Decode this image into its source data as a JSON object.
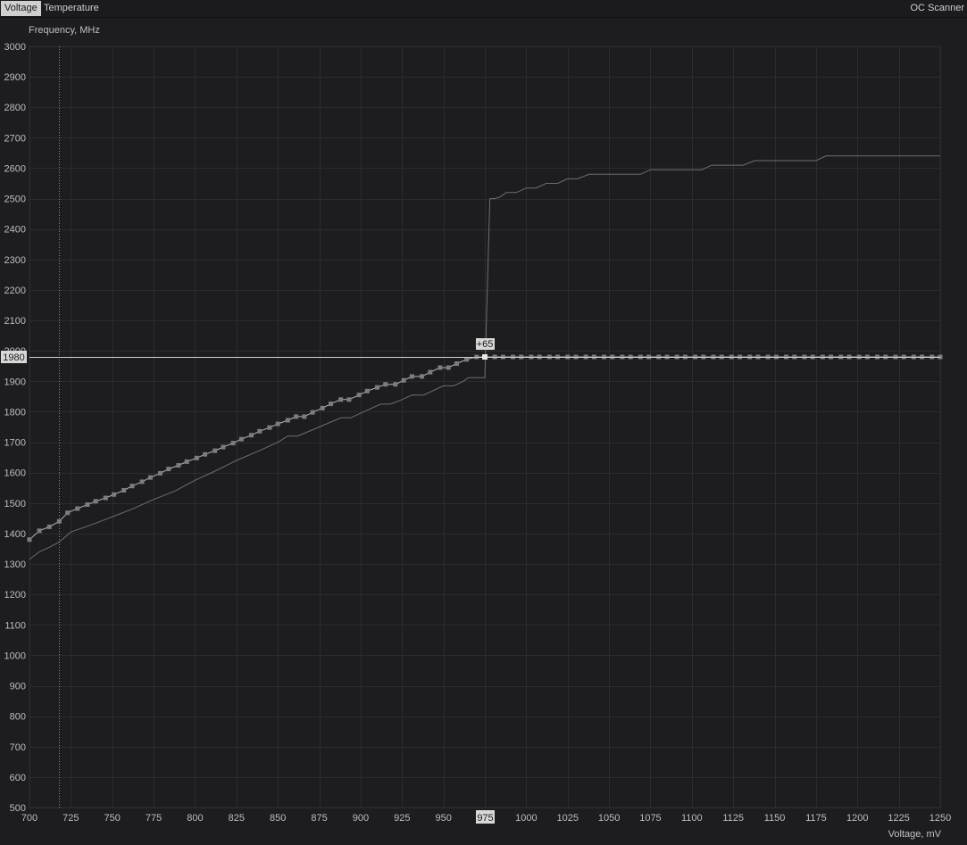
{
  "tabs": {
    "voltage": "Voltage",
    "temperature": "Temperature"
  },
  "oc_scanner": "OC Scanner",
  "colors": {
    "background": "#1d1d20",
    "grid": "#2c2c30",
    "curve": "#7a7a7c",
    "points": "#7d7d7f",
    "selected": "#e6e6e6"
  },
  "chart_data": {
    "type": "line",
    "ylabel": "Frequency, MHz",
    "xlabel": "Voltage, mV",
    "xlim": [
      700,
      1250
    ],
    "ylim": [
      500,
      3000
    ],
    "x_ticks": [
      700,
      725,
      750,
      775,
      800,
      825,
      850,
      875,
      900,
      925,
      950,
      975,
      1000,
      1025,
      1050,
      1075,
      1100,
      1125,
      1150,
      1175,
      1200,
      1225,
      1250
    ],
    "y_ticks": [
      500,
      600,
      700,
      800,
      900,
      1000,
      1100,
      1200,
      1300,
      1400,
      1500,
      1600,
      1700,
      1800,
      1900,
      2000,
      2100,
      2200,
      2300,
      2400,
      2500,
      2600,
      2700,
      2800,
      2900,
      3000
    ],
    "vertical_marker_voltage": 718,
    "selected_point": {
      "voltage": 975,
      "frequency": 1980,
      "offset_label": "+65",
      "voltage_label": "975",
      "frequency_label": "1980"
    },
    "series": [
      {
        "role": "default",
        "points": [
          [
            700,
            1315
          ],
          [
            706,
            1340
          ],
          [
            712,
            1355
          ],
          [
            718,
            1372
          ],
          [
            725,
            1405
          ],
          [
            738,
            1430
          ],
          [
            750,
            1455
          ],
          [
            762,
            1480
          ],
          [
            775,
            1512
          ],
          [
            788,
            1540
          ],
          [
            800,
            1575
          ],
          [
            812,
            1605
          ],
          [
            825,
            1640
          ],
          [
            838,
            1670
          ],
          [
            850,
            1700
          ],
          [
            856,
            1720
          ],
          [
            862,
            1720
          ],
          [
            875,
            1750
          ],
          [
            888,
            1780
          ],
          [
            894,
            1780
          ],
          [
            900,
            1795
          ],
          [
            912,
            1825
          ],
          [
            918,
            1825
          ],
          [
            925,
            1840
          ],
          [
            931,
            1855
          ],
          [
            938,
            1855
          ],
          [
            944,
            1870
          ],
          [
            950,
            1885
          ],
          [
            956,
            1885
          ],
          [
            962,
            1900
          ],
          [
            965,
            1912
          ],
          [
            972,
            1912
          ],
          [
            975,
            1912
          ],
          [
            978,
            2500
          ],
          [
            981,
            2500
          ],
          [
            984,
            2505
          ],
          [
            988,
            2520
          ],
          [
            994,
            2520
          ],
          [
            1000,
            2535
          ],
          [
            1006,
            2535
          ],
          [
            1012,
            2550
          ],
          [
            1019,
            2550
          ],
          [
            1025,
            2565
          ],
          [
            1031,
            2565
          ],
          [
            1038,
            2580
          ],
          [
            1050,
            2580
          ],
          [
            1069,
            2580
          ],
          [
            1075,
            2595
          ],
          [
            1094,
            2595
          ],
          [
            1106,
            2595
          ],
          [
            1112,
            2610
          ],
          [
            1131,
            2610
          ],
          [
            1138,
            2625
          ],
          [
            1175,
            2625
          ],
          [
            1181,
            2640
          ],
          [
            1250,
            2640
          ]
        ]
      },
      {
        "role": "edited",
        "points": [
          [
            700,
            1380
          ],
          [
            706,
            1409
          ],
          [
            712,
            1422
          ],
          [
            718,
            1440
          ],
          [
            723,
            1468
          ],
          [
            729,
            1482
          ],
          [
            735,
            1495
          ],
          [
            740,
            1506
          ],
          [
            746,
            1517
          ],
          [
            751,
            1528
          ],
          [
            757,
            1542
          ],
          [
            762,
            1556
          ],
          [
            768,
            1570
          ],
          [
            773,
            1584
          ],
          [
            779,
            1598
          ],
          [
            784,
            1612
          ],
          [
            790,
            1624
          ],
          [
            795,
            1636
          ],
          [
            801,
            1648
          ],
          [
            806,
            1660
          ],
          [
            812,
            1672
          ],
          [
            817,
            1684
          ],
          [
            823,
            1697
          ],
          [
            828,
            1710
          ],
          [
            834,
            1723
          ],
          [
            839,
            1736
          ],
          [
            845,
            1748
          ],
          [
            850,
            1760
          ],
          [
            856,
            1772
          ],
          [
            861,
            1784
          ],
          [
            866,
            1784
          ],
          [
            871,
            1798
          ],
          [
            877,
            1812
          ],
          [
            882,
            1826
          ],
          [
            888,
            1840
          ],
          [
            893,
            1840
          ],
          [
            899,
            1855
          ],
          [
            904,
            1868
          ],
          [
            910,
            1880
          ],
          [
            915,
            1890
          ],
          [
            921,
            1890
          ],
          [
            926,
            1903
          ],
          [
            931,
            1916
          ],
          [
            937,
            1916
          ],
          [
            942,
            1930
          ],
          [
            948,
            1945
          ],
          [
            953,
            1945
          ],
          [
            958,
            1958
          ],
          [
            964,
            1972
          ],
          [
            970,
            1980
          ],
          [
            975,
            1980
          ],
          [
            981,
            1980
          ],
          [
            986,
            1980
          ],
          [
            992,
            1980
          ],
          [
            997,
            1980
          ],
          [
            1003,
            1980
          ],
          [
            1008,
            1980
          ],
          [
            1014,
            1980
          ],
          [
            1019,
            1980
          ],
          [
            1025,
            1980
          ],
          [
            1030,
            1980
          ],
          [
            1036,
            1980
          ],
          [
            1041,
            1980
          ],
          [
            1047,
            1980
          ],
          [
            1052,
            1980
          ],
          [
            1058,
            1980
          ],
          [
            1063,
            1980
          ],
          [
            1069,
            1980
          ],
          [
            1074,
            1980
          ],
          [
            1080,
            1980
          ],
          [
            1085,
            1980
          ],
          [
            1091,
            1980
          ],
          [
            1096,
            1980
          ],
          [
            1102,
            1980
          ],
          [
            1107,
            1980
          ],
          [
            1113,
            1980
          ],
          [
            1118,
            1980
          ],
          [
            1124,
            1980
          ],
          [
            1129,
            1980
          ],
          [
            1135,
            1980
          ],
          [
            1140,
            1980
          ],
          [
            1146,
            1980
          ],
          [
            1151,
            1980
          ],
          [
            1157,
            1980
          ],
          [
            1162,
            1980
          ],
          [
            1168,
            1980
          ],
          [
            1173,
            1980
          ],
          [
            1179,
            1980
          ],
          [
            1184,
            1980
          ],
          [
            1190,
            1980
          ],
          [
            1195,
            1980
          ],
          [
            1201,
            1980
          ],
          [
            1206,
            1980
          ],
          [
            1212,
            1980
          ],
          [
            1217,
            1980
          ],
          [
            1223,
            1980
          ],
          [
            1228,
            1980
          ],
          [
            1234,
            1980
          ],
          [
            1239,
            1980
          ],
          [
            1245,
            1980
          ],
          [
            1250,
            1980
          ]
        ]
      }
    ]
  }
}
